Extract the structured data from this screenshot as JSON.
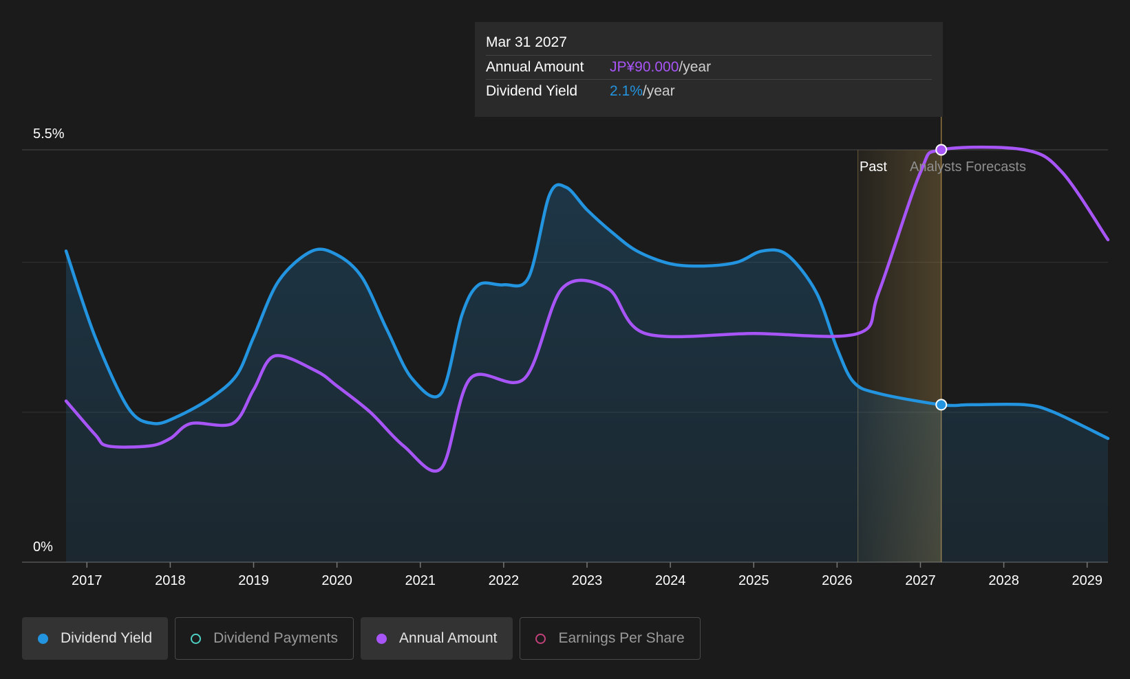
{
  "tooltip": {
    "date": "Mar 31 2027",
    "annual_label": "Annual Amount",
    "annual_value": "JP¥90.000",
    "annual_unit": "/year",
    "yield_label": "Dividend Yield",
    "yield_value": "2.1%",
    "yield_unit": "/year"
  },
  "regions": {
    "past_label": "Past",
    "forecast_label": "Analysts Forecasts"
  },
  "legend": [
    {
      "label": "Dividend Yield",
      "color": "#2394df",
      "active": true,
      "filled": true
    },
    {
      "label": "Dividend Payments",
      "color": "#4fd1c5",
      "active": false,
      "filled": false
    },
    {
      "label": "Annual Amount",
      "color": "#a855f7",
      "active": true,
      "filled": true
    },
    {
      "label": "Earnings Per Share",
      "color": "#c2417a",
      "active": false,
      "filled": false
    }
  ],
  "chart_data": {
    "type": "line",
    "y_axis": {
      "top_label": "5.5%",
      "bottom_label": "0%",
      "ylim": [
        0,
        5.5
      ],
      "gridlines": [
        0,
        2.0,
        4.0,
        5.5
      ]
    },
    "x_axis": {
      "ticks": [
        "2017",
        "2018",
        "2019",
        "2020",
        "2021",
        "2022",
        "2023",
        "2024",
        "2025",
        "2026",
        "2027",
        "2028",
        "2029"
      ],
      "xlim": [
        2016.75,
        2029.25
      ]
    },
    "past_forecast_divider": 2026.25,
    "hover_x": 2027.25,
    "colors": {
      "dividend_yield": "#2394df",
      "annual_amount": "#a855f7",
      "forecast_band": "#c8a050"
    },
    "series": [
      {
        "name": "Dividend Yield",
        "unit": "%",
        "points": [
          [
            2016.75,
            4.15
          ],
          [
            2017.1,
            3.0
          ],
          [
            2017.5,
            2.05
          ],
          [
            2017.8,
            1.85
          ],
          [
            2018.1,
            1.95
          ],
          [
            2018.5,
            2.2
          ],
          [
            2018.8,
            2.5
          ],
          [
            2019.0,
            3.0
          ],
          [
            2019.3,
            3.75
          ],
          [
            2019.7,
            4.15
          ],
          [
            2020.0,
            4.1
          ],
          [
            2020.3,
            3.8
          ],
          [
            2020.6,
            3.1
          ],
          [
            2020.9,
            2.45
          ],
          [
            2021.25,
            2.25
          ],
          [
            2021.5,
            3.3
          ],
          [
            2021.7,
            3.7
          ],
          [
            2022.0,
            3.7
          ],
          [
            2022.3,
            3.8
          ],
          [
            2022.55,
            4.9
          ],
          [
            2022.75,
            5.0
          ],
          [
            2023.0,
            4.7
          ],
          [
            2023.3,
            4.4
          ],
          [
            2023.6,
            4.15
          ],
          [
            2024.0,
            3.98
          ],
          [
            2024.4,
            3.95
          ],
          [
            2024.8,
            4.0
          ],
          [
            2025.1,
            4.15
          ],
          [
            2025.4,
            4.1
          ],
          [
            2025.75,
            3.6
          ],
          [
            2026.0,
            2.85
          ],
          [
            2026.2,
            2.4
          ],
          [
            2026.5,
            2.25
          ],
          [
            2027.25,
            2.1
          ],
          [
            2027.6,
            2.1
          ],
          [
            2028.25,
            2.1
          ],
          [
            2028.6,
            2.0
          ],
          [
            2029.25,
            1.65
          ]
        ]
      },
      {
        "name": "Annual Amount",
        "unit": "% of chart scale",
        "points": [
          [
            2016.75,
            2.15
          ],
          [
            2017.1,
            1.7
          ],
          [
            2017.25,
            1.55
          ],
          [
            2017.75,
            1.55
          ],
          [
            2018.0,
            1.65
          ],
          [
            2018.25,
            1.85
          ],
          [
            2018.75,
            1.85
          ],
          [
            2019.0,
            2.3
          ],
          [
            2019.25,
            2.75
          ],
          [
            2019.75,
            2.55
          ],
          [
            2020.0,
            2.35
          ],
          [
            2020.4,
            2.0
          ],
          [
            2020.8,
            1.55
          ],
          [
            2021.25,
            1.25
          ],
          [
            2021.6,
            2.45
          ],
          [
            2022.25,
            2.45
          ],
          [
            2022.7,
            3.65
          ],
          [
            2023.25,
            3.65
          ],
          [
            2023.7,
            3.05
          ],
          [
            2025.0,
            3.05
          ],
          [
            2026.25,
            3.05
          ],
          [
            2026.5,
            3.6
          ],
          [
            2027.0,
            5.2
          ],
          [
            2027.25,
            5.5
          ],
          [
            2028.25,
            5.5
          ],
          [
            2028.7,
            5.2
          ],
          [
            2029.25,
            4.3
          ]
        ]
      }
    ]
  }
}
